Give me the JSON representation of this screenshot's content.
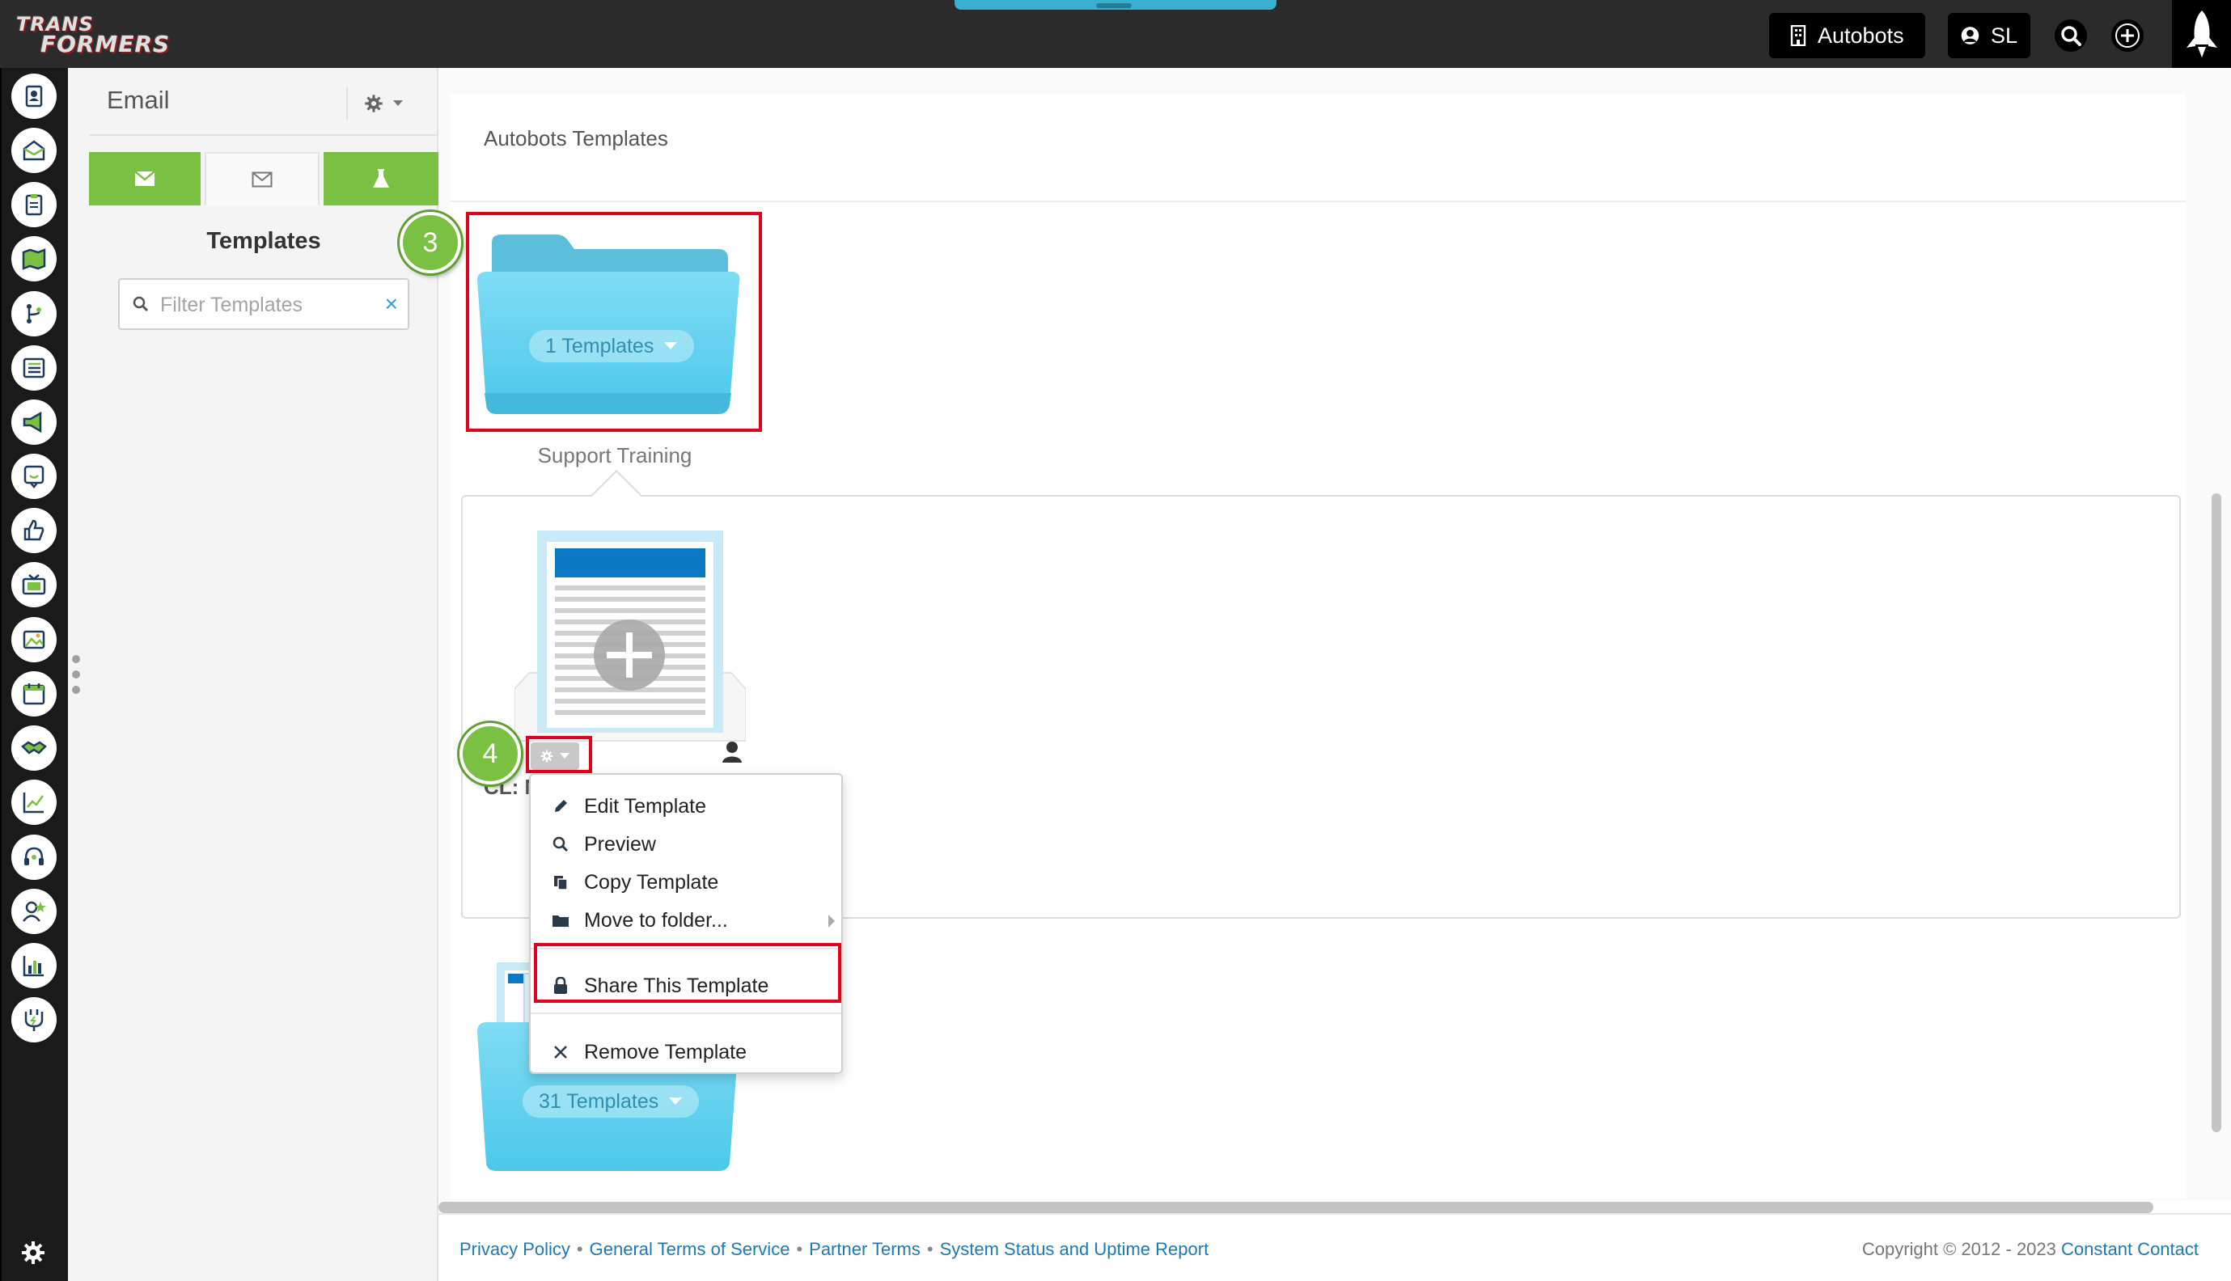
{
  "brand": {
    "logo_line1": "TRANS",
    "logo_line2": "FORMERS"
  },
  "topbar": {
    "org_label": "Autobots",
    "user_initials": "SL"
  },
  "rail_icons": [
    "contacts-icon",
    "inbox-icon",
    "clipboard-icon",
    "map-icon",
    "workflow-icon",
    "list-icon",
    "megaphone-icon",
    "feedback-icon",
    "thumbs-up-icon",
    "tv-icon",
    "gallery-icon",
    "calendar-icon",
    "handshake-icon",
    "growth-chart-icon",
    "headset-icon",
    "user-star-icon",
    "bar-chart-icon",
    "plug-icon"
  ],
  "sidebar": {
    "title": "Email",
    "section_title": "Templates",
    "filter": {
      "placeholder": "Filter Templates",
      "value": ""
    }
  },
  "main": {
    "breadcrumb": "Autobots Templates",
    "folders": [
      {
        "name": "Support Training",
        "count_label": "1 Templates"
      },
      {
        "name": "",
        "count_label": "31 Templates"
      }
    ],
    "template": {
      "name_fragment": "CL: N"
    }
  },
  "steps": {
    "step3": "3",
    "step4": "4"
  },
  "context_menu": {
    "items": [
      {
        "label": "Edit Template",
        "icon": "pencil-icon"
      },
      {
        "label": "Preview",
        "icon": "search-icon"
      },
      {
        "label": "Copy Template",
        "icon": "copy-icon"
      },
      {
        "label": "Move to folder...",
        "icon": "folder-icon"
      },
      {
        "label": "Share This Template",
        "icon": "lock-icon"
      },
      {
        "label": "Remove Template",
        "icon": "close-icon"
      }
    ]
  },
  "footer": {
    "links": [
      "Privacy Policy",
      "General Terms of Service",
      "Partner Terms",
      "System Status and Uptime Report"
    ],
    "separator": "•",
    "copyright": "Copyright © 2012 - 2023",
    "copyright_link": "Constant Contact"
  },
  "colors": {
    "accent_green": "#7ac143",
    "highlight_red": "#e3001b",
    "folder_blue": "#5fd0ee",
    "link_blue": "#1a7ab8"
  }
}
